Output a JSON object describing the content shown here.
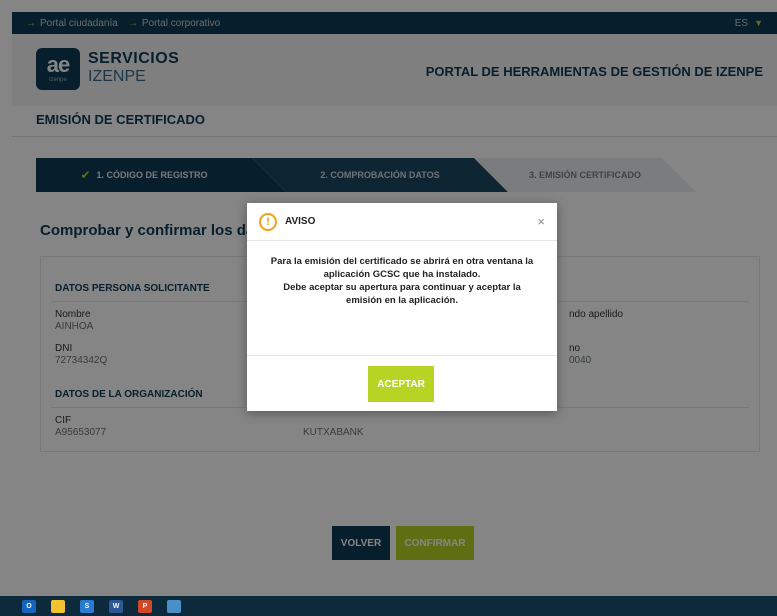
{
  "topbar": {
    "link1": "Portal ciudadanía",
    "link2": "Portal corporativo",
    "language": "ES"
  },
  "header": {
    "logo_mark": "ae",
    "logo_caption": "izenpe",
    "brand_line1": "SERVICIOS",
    "brand_line2": "IZENPE",
    "portal_title": "PORTAL DE HERRAMIENTAS DE GESTIÓN DE IZENPE"
  },
  "page": {
    "section_title": "EMISIÓN DE CERTIFICADO",
    "confirm_title": "Comprobar y confirmar los datos"
  },
  "steps": [
    {
      "label": "1. CÓDIGO DE REGISTRO",
      "state": "done"
    },
    {
      "label": "2. COMPROBACIÓN DATOS",
      "state": "active"
    },
    {
      "label": "3. EMISIÓN CERTIFICADO",
      "state": "pending"
    }
  ],
  "datos_persona": {
    "heading": "DATOS PERSONA SOLICITANTE",
    "nombre_label": "Nombre",
    "nombre_value": "AINHOA",
    "segundo_apellido_label": "ndo apellido",
    "dni_label": "DNI",
    "dni_value": "72734342Q",
    "telefono_label": "no",
    "telefono_value": "0040"
  },
  "datos_organizacion": {
    "heading": "DATOS DE LA ORGANIZACIÓN",
    "cif_label": "CIF",
    "cif_value": "A95653077",
    "razon_value": "KUTXABANK"
  },
  "buttons": {
    "volver": "VOLVER",
    "confirmar": "CONFIRMAR"
  },
  "modal": {
    "title": "AVISO",
    "close": "×",
    "icon_glyph": "!",
    "body_line1": "Para la emisión del certificado se abrirá en otra ventana la",
    "body_line2": "aplicación GCSC que ha instalado.",
    "body_line3": "Debe aceptar su apertura para continuar y aceptar la",
    "body_line4": "emisión en la aplicación.",
    "accept": "ACEPTAR"
  },
  "taskbar": {
    "icons": [
      {
        "name": "outlook-icon",
        "glyph": "O",
        "color": "#1565c0"
      },
      {
        "name": "file-explorer-icon",
        "glyph": "",
        "color": "#f2c230"
      },
      {
        "name": "skype-icon",
        "glyph": "S",
        "color": "#2a7bd1"
      },
      {
        "name": "word-icon",
        "glyph": "W",
        "color": "#2b5797"
      },
      {
        "name": "powerpoint-icon",
        "glyph": "P",
        "color": "#d24726"
      },
      {
        "name": "photos-icon",
        "glyph": "",
        "color": "#4a90c8"
      }
    ]
  },
  "colors": {
    "navy": "#0f3a55",
    "lime": "#b7d425",
    "warning": "#f0a21a"
  }
}
